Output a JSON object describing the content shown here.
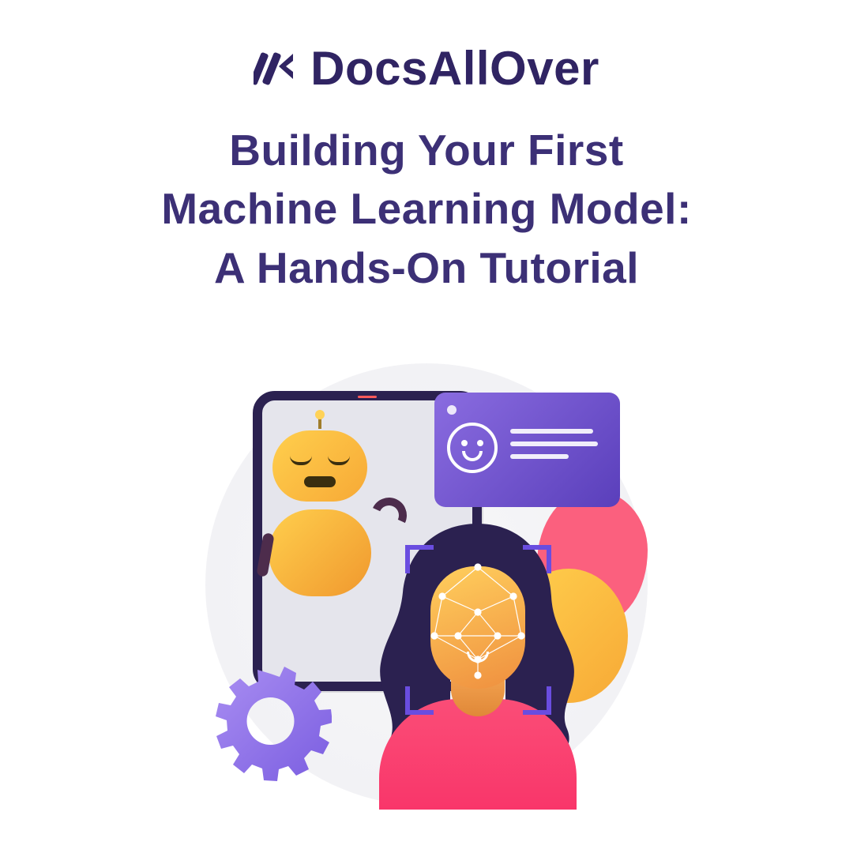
{
  "brand": {
    "name": "DocsAllOver"
  },
  "title": {
    "line1": "Building Your First",
    "line2": "Machine Learning Model:",
    "line3": "A Hands-On Tutorial"
  },
  "colors": {
    "primary": "#302463",
    "accent_purple": "#6a4de0",
    "accent_yellow": "#f7a936",
    "accent_pink": "#fb607e"
  }
}
